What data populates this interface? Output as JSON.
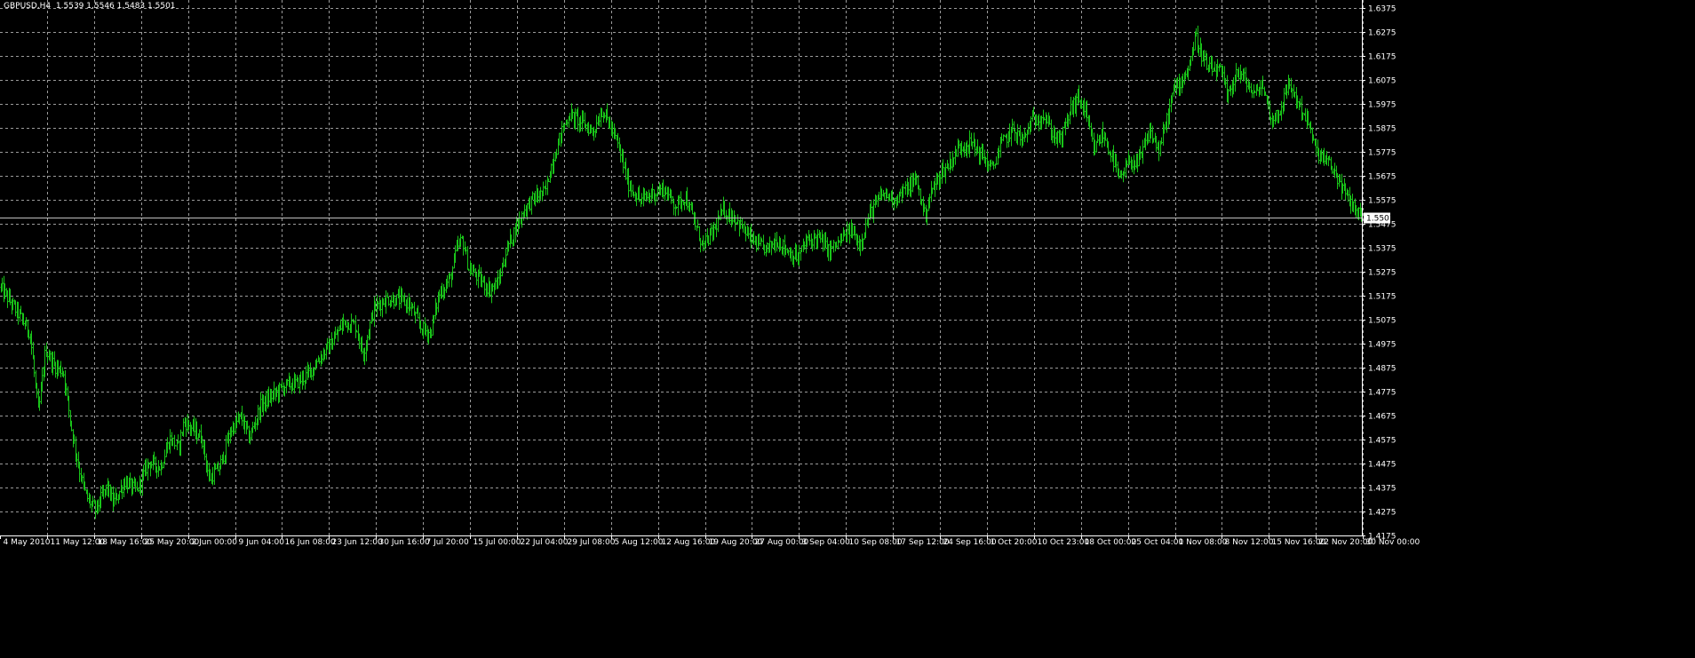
{
  "chart_info": {
    "symbol": "GBPUSD,H4",
    "open": "1.5539",
    "high": "1.5546",
    "low": "1.5483",
    "close": "1.5501"
  },
  "colors": {
    "background": "#000000",
    "bars": "#19c419",
    "grid": "#9a9a9a",
    "axis": "#ffffff",
    "bid_line": "#c0c0c0",
    "price_label_bg": "#ffffff",
    "price_label_text": "#000000"
  },
  "chart_data": {
    "type": "bar",
    "style": "ohlc-bars",
    "timeframe": "H4",
    "grid": true,
    "ylim": [
      1.4175,
      1.6375
    ],
    "y_ticks": [
      "1.6375",
      "1.6275",
      "1.6175",
      "1.6075",
      "1.5975",
      "1.5875",
      "1.5775",
      "1.5675",
      "1.5575",
      "1.5475",
      "1.5375",
      "1.5275",
      "1.5175",
      "1.5075",
      "1.4975",
      "1.4875",
      "1.4775",
      "1.4675",
      "1.4575",
      "1.4475",
      "1.4375",
      "1.4275",
      "1.4175"
    ],
    "x_ticks": [
      "4 May 2010",
      "11 May 12:00",
      "18 May 16:00",
      "25 May 20:00",
      "2 Jun 00:00",
      "9 Jun 04:00",
      "16 Jun 08:00",
      "23 Jun 12:00",
      "30 Jun 16:00",
      "7 Jul 20:00",
      "15 Jul 00:00",
      "22 Jul 04:00",
      "29 Jul 08:00",
      "5 Aug 12:00",
      "12 Aug 16:00",
      "19 Aug 20:00",
      "27 Aug 00:00",
      "3 Sep 04:00",
      "10 Sep 08:00",
      "17 Sep 12:00",
      "24 Sep 16:00",
      "1 Oct 20:00",
      "10 Oct 23:00",
      "18 Oct 00:00",
      "25 Oct 04:00",
      "1 Nov 08:00",
      "8 Nov 12:00",
      "15 Nov 16:00",
      "22 Nov 20:00",
      "30 Nov 00:00"
    ],
    "current_price": "1.5501",
    "close_path": [
      [
        0,
        1.521
      ],
      [
        1.5,
        1.51
      ],
      [
        2.5,
        1.502
      ],
      [
        3.2,
        1.468
      ],
      [
        3.8,
        1.495
      ],
      [
        4.6,
        1.488
      ],
      [
        5.3,
        1.486
      ],
      [
        6.0,
        1.462
      ],
      [
        6.6,
        1.446
      ],
      [
        7.2,
        1.434
      ],
      [
        8.0,
        1.428
      ],
      [
        9.0,
        1.438
      ],
      [
        9.5,
        1.431
      ],
      [
        10.5,
        1.44
      ],
      [
        11.5,
        1.436
      ],
      [
        12.5,
        1.448
      ],
      [
        13.5,
        1.446
      ],
      [
        14.3,
        1.458
      ],
      [
        15.0,
        1.454
      ],
      [
        15.5,
        1.465
      ],
      [
        16.2,
        1.462
      ],
      [
        17.0,
        1.458
      ],
      [
        17.6,
        1.441
      ],
      [
        18.5,
        1.446
      ],
      [
        19.5,
        1.462
      ],
      [
        20.3,
        1.467
      ],
      [
        21.0,
        1.458
      ],
      [
        22.0,
        1.472
      ],
      [
        23.0,
        1.476
      ],
      [
        24.0,
        1.48
      ],
      [
        25.0,
        1.481
      ],
      [
        26.0,
        1.485
      ],
      [
        27.0,
        1.492
      ],
      [
        28.0,
        1.498
      ],
      [
        29.0,
        1.507
      ],
      [
        30.0,
        1.505
      ],
      [
        30.6,
        1.493
      ],
      [
        31.5,
        1.512
      ],
      [
        32.5,
        1.516
      ],
      [
        33.5,
        1.516
      ],
      [
        34.5,
        1.514
      ],
      [
        35.5,
        1.504
      ],
      [
        36.3,
        1.502
      ],
      [
        37.0,
        1.518
      ],
      [
        38.0,
        1.525
      ],
      [
        38.5,
        1.537
      ],
      [
        39.0,
        1.541
      ],
      [
        39.5,
        1.529
      ],
      [
        40.5,
        1.524
      ],
      [
        41.3,
        1.52
      ],
      [
        42.0,
        1.523
      ],
      [
        42.8,
        1.538
      ],
      [
        43.5,
        1.546
      ],
      [
        44.3,
        1.554
      ],
      [
        45.0,
        1.558
      ],
      [
        46.0,
        1.561
      ],
      [
        46.5,
        1.572
      ],
      [
        47.3,
        1.585
      ],
      [
        48.0,
        1.593
      ],
      [
        49.0,
        1.59
      ],
      [
        50.0,
        1.586
      ],
      [
        50.8,
        1.595
      ],
      [
        51.5,
        1.588
      ],
      [
        52.2,
        1.579
      ],
      [
        53.0,
        1.564
      ],
      [
        54.0,
        1.557
      ],
      [
        55.0,
        1.56
      ],
      [
        56.0,
        1.562
      ],
      [
        57.0,
        1.555
      ],
      [
        57.8,
        1.559
      ],
      [
        58.5,
        1.549
      ],
      [
        59.3,
        1.538
      ],
      [
        60.0,
        1.543
      ],
      [
        61.0,
        1.553
      ],
      [
        62.0,
        1.55
      ],
      [
        63.0,
        1.543
      ],
      [
        64.0,
        1.538
      ],
      [
        64.8,
        1.537
      ],
      [
        65.5,
        1.541
      ],
      [
        66.5,
        1.536
      ],
      [
        67.3,
        1.533
      ],
      [
        68.0,
        1.54
      ],
      [
        69.0,
        1.542
      ],
      [
        70.0,
        1.536
      ],
      [
        71.0,
        1.541
      ],
      [
        71.8,
        1.545
      ],
      [
        72.5,
        1.539
      ],
      [
        73.5,
        1.553
      ],
      [
        74.5,
        1.56
      ],
      [
        75.5,
        1.558
      ],
      [
        76.5,
        1.562
      ],
      [
        77.3,
        1.566
      ],
      [
        78.0,
        1.551
      ],
      [
        78.5,
        1.56
      ],
      [
        79.3,
        1.568
      ],
      [
        80.0,
        1.572
      ],
      [
        81.0,
        1.58
      ],
      [
        82.0,
        1.581
      ],
      [
        83.0,
        1.575
      ],
      [
        83.7,
        1.57
      ],
      [
        84.5,
        1.581
      ],
      [
        85.5,
        1.587
      ],
      [
        86.3,
        1.582
      ],
      [
        87.0,
        1.59
      ],
      [
        88.0,
        1.593
      ],
      [
        88.8,
        1.585
      ],
      [
        89.5,
        1.582
      ],
      [
        90.3,
        1.595
      ],
      [
        91.0,
        1.6
      ],
      [
        91.5,
        1.595
      ],
      [
        92.3,
        1.578
      ],
      [
        93.0,
        1.585
      ],
      [
        93.8,
        1.576
      ],
      [
        94.5,
        1.565
      ],
      [
        95.3,
        1.574
      ],
      [
        96.0,
        1.572
      ],
      [
        97.0,
        1.586
      ],
      [
        97.8,
        1.578
      ],
      [
        98.5,
        1.592
      ],
      [
        99.0,
        1.603
      ],
      [
        99.5,
        1.606
      ],
      [
        100.3,
        1.613
      ],
      [
        100.9,
        1.626
      ],
      [
        101.5,
        1.616
      ],
      [
        102.0,
        1.612
      ],
      [
        103.0,
        1.611
      ],
      [
        103.6,
        1.6
      ],
      [
        104.3,
        1.611
      ],
      [
        105.0,
        1.608
      ],
      [
        105.8,
        1.601
      ],
      [
        106.5,
        1.606
      ],
      [
        107.3,
        1.59
      ],
      [
        108.0,
        1.595
      ],
      [
        108.8,
        1.606
      ],
      [
        109.5,
        1.598
      ],
      [
        110.3,
        1.591
      ],
      [
        111.0,
        1.578
      ],
      [
        111.8,
        1.574
      ],
      [
        112.5,
        1.57
      ],
      [
        113.3,
        1.562
      ],
      [
        114.0,
        1.556
      ],
      [
        114.8,
        1.551
      ]
    ],
    "close_path_x_scale": [
      0,
      114.8
    ]
  }
}
